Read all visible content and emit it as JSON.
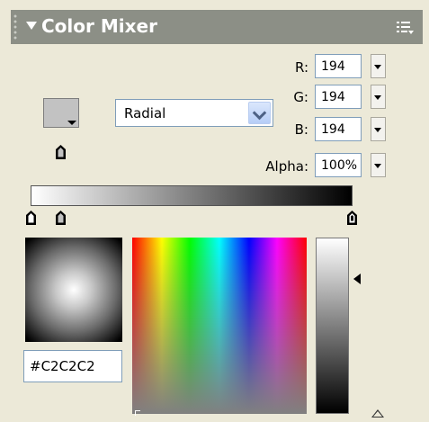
{
  "panel": {
    "title": "Color Mixer",
    "menu_icon": "options-menu-icon"
  },
  "colors": {
    "current_fill": "#C2C2C2",
    "title_bar": "#8c8f86",
    "panel_bg": "#ece9d8"
  },
  "fill_type": {
    "selected": "Radial"
  },
  "rgb": {
    "r_label": "R:",
    "r_value": "194",
    "g_label": "G:",
    "g_value": "194",
    "b_label": "B:",
    "b_value": "194",
    "alpha_label": "Alpha:",
    "alpha_value": "100%"
  },
  "gradient": {
    "stops": [
      "#ffffff",
      "#c2c2c2",
      "#000000"
    ]
  },
  "hex": {
    "value": "#C2C2C2"
  }
}
